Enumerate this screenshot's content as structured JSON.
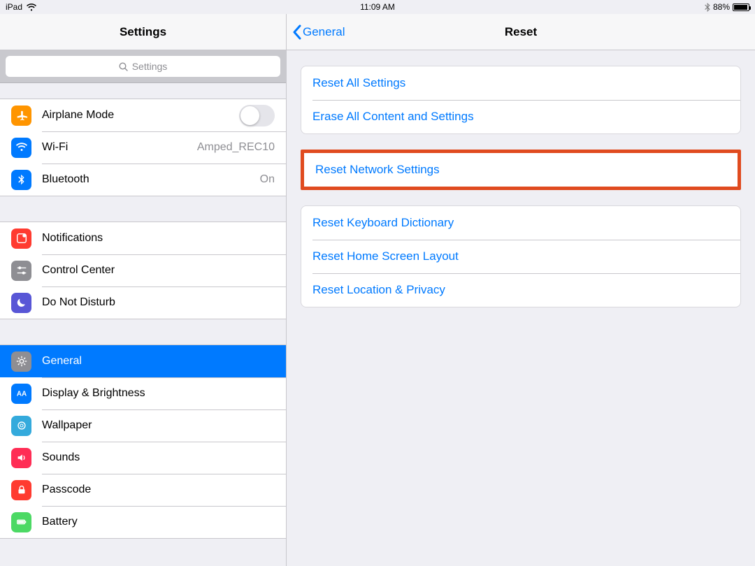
{
  "status": {
    "carrier": "iPad",
    "time": "11:09 AM",
    "battery_pct": "88%"
  },
  "sidebar": {
    "title": "Settings",
    "search_placeholder": "Settings",
    "group1": {
      "airplane": "Airplane Mode",
      "wifi": "Wi-Fi",
      "wifi_value": "Amped_REC10",
      "bluetooth": "Bluetooth",
      "bluetooth_value": "On"
    },
    "group2": {
      "notifications": "Notifications",
      "control_center": "Control Center",
      "dnd": "Do Not Disturb"
    },
    "group3": {
      "general": "General",
      "display": "Display & Brightness",
      "wallpaper": "Wallpaper",
      "sounds": "Sounds",
      "passcode": "Passcode",
      "battery": "Battery"
    }
  },
  "detail": {
    "back_label": "General",
    "title": "Reset",
    "g1": {
      "reset_all": "Reset All Settings",
      "erase_all": "Erase All Content and Settings"
    },
    "g2": {
      "reset_network": "Reset Network Settings"
    },
    "g3": {
      "keyboard": "Reset Keyboard Dictionary",
      "home": "Reset Home Screen Layout",
      "location": "Reset Location & Privacy"
    }
  }
}
